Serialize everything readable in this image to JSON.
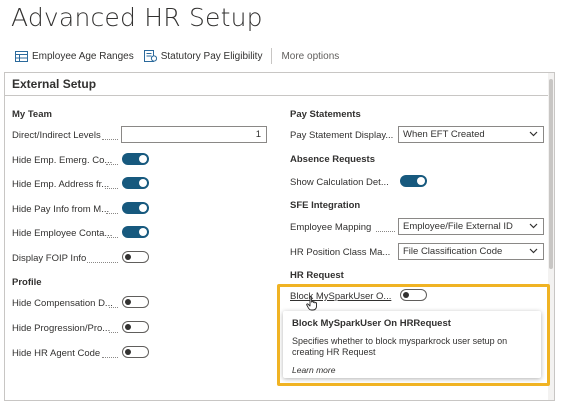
{
  "page": {
    "title": "Advanced HR Setup"
  },
  "actionbar": {
    "actions": [
      {
        "label": "Employee Age Ranges",
        "icon": "table-icon"
      },
      {
        "label": "Statutory Pay Eligibility",
        "icon": "pay-icon"
      }
    ],
    "more_label": "More options"
  },
  "panel": {
    "title": "External Setup"
  },
  "my_team": {
    "title": "My Team",
    "fields": [
      {
        "label": "Direct/Indirect Levels",
        "type": "number",
        "value": "1"
      },
      {
        "label": "Hide Emp. Emerg. Co...",
        "type": "toggle",
        "on": true
      },
      {
        "label": "Hide Emp. Address fr...",
        "type": "toggle",
        "on": true
      },
      {
        "label": "Hide Pay Info from M...",
        "type": "toggle",
        "on": true
      },
      {
        "label": "Hide Employee Conta...",
        "type": "toggle",
        "on": true
      },
      {
        "label": "Display FOIP Info",
        "type": "toggle",
        "on": false
      }
    ]
  },
  "profile": {
    "title": "Profile",
    "fields": [
      {
        "label": "Hide Compensation D...",
        "type": "toggle",
        "on": false
      },
      {
        "label": "Hide Progression/Pro...",
        "type": "toggle",
        "on": false
      },
      {
        "label": "Hide HR Agent Code",
        "type": "toggle",
        "on": false
      }
    ]
  },
  "pay_statements": {
    "title": "Pay Statements",
    "fields": [
      {
        "label": "Pay Statement Display...",
        "type": "select",
        "value": "When EFT Created"
      }
    ]
  },
  "absence_requests": {
    "title": "Absence Requests",
    "fields": [
      {
        "label": "Show Calculation Det...",
        "type": "toggle",
        "on": true
      }
    ]
  },
  "sfe_integration": {
    "title": "SFE Integration",
    "fields": [
      {
        "label": "Employee Mapping",
        "type": "select",
        "value": "Employee/File External ID"
      },
      {
        "label": "HR Position Class Ma...",
        "type": "select",
        "value": "File Classification Code"
      }
    ]
  },
  "hr_request": {
    "title": "HR Request",
    "fields": [
      {
        "label": "Block MySparkUser O...",
        "type": "toggle",
        "on": false
      }
    ]
  },
  "tooltip": {
    "title": "Block MySparkUser On HRRequest",
    "body": "Specifies whether to block mysparkrock user setup on creating HR Request",
    "learn_more": "Learn more"
  },
  "colors": {
    "toggle_on": "#17597e",
    "highlight": "#f0b323"
  }
}
